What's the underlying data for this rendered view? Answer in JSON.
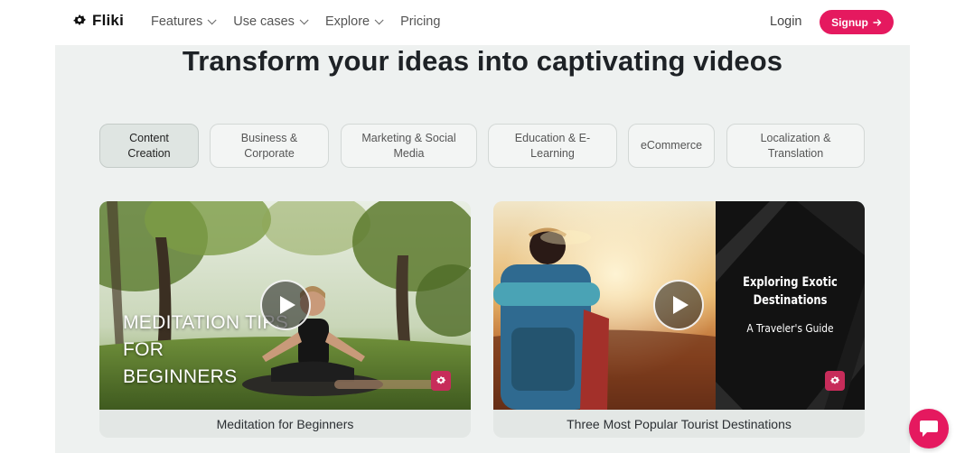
{
  "nav": {
    "logo": "Fliki",
    "menu": [
      {
        "label": "Features",
        "dropdown": true
      },
      {
        "label": "Use cases",
        "dropdown": true
      },
      {
        "label": "Explore",
        "dropdown": true
      },
      {
        "label": "Pricing",
        "dropdown": false
      }
    ],
    "login": "Login",
    "signup": "Signup",
    "signup_icon": "arrow-right-icon"
  },
  "headline": "Transform your ideas into captivating videos",
  "tabs": [
    {
      "label": "Content Creation",
      "active": true
    },
    {
      "label": "Business & Corporate",
      "active": false
    },
    {
      "label": "Marketing & Social Media",
      "active": false
    },
    {
      "label": "Education & E-Learning",
      "active": false
    },
    {
      "label": "eCommerce",
      "active": false
    },
    {
      "label": "Localization & Translation",
      "active": false
    }
  ],
  "cards": [
    {
      "overlay": "MEDITATION TIPS\nFOR\nBEGINNERS",
      "caption": "Meditation for Beginners"
    },
    {
      "overlay_title": "Exploring Exotic\nDestinations",
      "overlay_subtitle": "A Traveler's Guide",
      "caption": "Three Most Popular Tourist Destinations"
    }
  ],
  "colors": {
    "accent": "#e5195f",
    "panel_bg": "#eef1f0"
  },
  "chat_icon": "chat-bubble-icon"
}
